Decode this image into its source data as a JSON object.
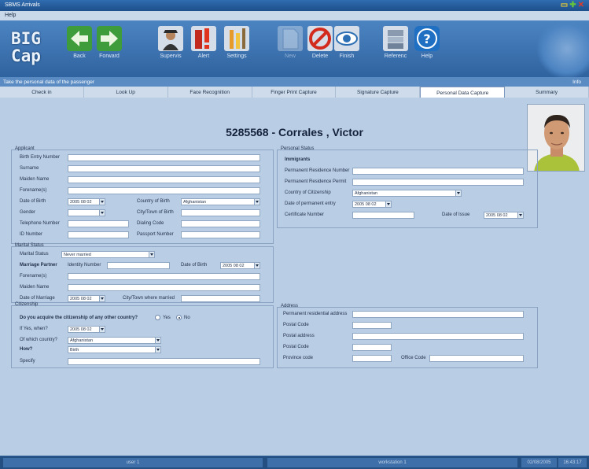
{
  "window": {
    "title": "SBMS Arrivals"
  },
  "menu": {
    "help": "Help"
  },
  "toolbar": {
    "logo": "BIG\nCap",
    "back": "Back",
    "forward": "Forward",
    "supervis": "Supervis",
    "alert": "Alert",
    "settings": "Settings",
    "new": "New",
    "delete": "Delete",
    "finish": "Finish",
    "reference": "Referenc",
    "help": "Help"
  },
  "status": {
    "instruction": "Take the personal data of the passenger",
    "info": "Info"
  },
  "tabs": [
    {
      "label": "Check in"
    },
    {
      "label": "Look Up"
    },
    {
      "label": "Face Recognition"
    },
    {
      "label": "Finger Print Capture"
    },
    {
      "label": "Signature Capture"
    },
    {
      "label": "Personal Data Capture"
    },
    {
      "label": "Summary"
    }
  ],
  "main": {
    "headline": "5285568 - Corrales , Victor"
  },
  "applicant": {
    "title": "Applicant",
    "birth_entry_number": "Birth Entry Number",
    "surname": "Surname",
    "maiden_name": "Maiden Name",
    "forenames": "Forename(s)",
    "date_of_birth": "Date of Birth",
    "date_of_birth_value": "2005 08 02",
    "country_of_birth": "Country of Birth",
    "country_of_birth_value": "Afghanistan",
    "gender": "Gender",
    "city_of_birth": "City/Town of Birth",
    "telephone": "Telephone Number",
    "dialing_code": "Dialing Code",
    "id_number": "ID Number",
    "passport_number": "Passport Number"
  },
  "marital": {
    "title": "Marital Status",
    "status_label": "Marital Status",
    "status_value": "Never married",
    "partner": "Marriage Partner",
    "identity_number": "Identity Number",
    "date_of_birth": "Date of Birth",
    "date_of_birth_value": "2005 08 02",
    "forenames": "Forename(s)",
    "maiden_name": "Maiden Name",
    "date_of_marriage": "Date of Marriage",
    "date_of_marriage_value": "2005 08 02",
    "city_married": "City/Town where married"
  },
  "citizenship": {
    "title": "Citizenship",
    "question": "Do you acquire the citizenship of any other country?",
    "yes": "Yes",
    "no": "No",
    "if_yes_when": "If Yes, when?",
    "if_yes_when_value": "2005 08 02",
    "which_country": "Of which country?",
    "which_country_value": "Afghanistan",
    "how": "How?",
    "how_value": "Birth",
    "specify": "Specify"
  },
  "personal_status": {
    "title": "Personal Status",
    "immigrants": "Immigrants",
    "permanent_residence_number": "Permanent Residence Number",
    "permanent_residence_permit": "Permanent Residence Permit",
    "country_of_citizenship": "Country of Citizenship",
    "country_of_citizenship_value": "Afghanistan",
    "date_of_permanent_entry": "Date of permanent entry",
    "date_of_permanent_entry_value": "2005 08 02",
    "certificate_number": "Certificate Number",
    "date_of_issue": "Date of Issue",
    "date_of_issue_value": "2005 08 02"
  },
  "address": {
    "title": "Address",
    "permanent_residential": "Permanent residential address",
    "postal_code_1": "Postal Code",
    "postal_address": "Postal address",
    "postal_code_2": "Postal Code",
    "province_code": "Province code",
    "office_code": "Office Code"
  },
  "footer": {
    "user": "user 1",
    "workstation": "workstation 1",
    "date": "02/08/2005",
    "time": "16:43:17"
  }
}
